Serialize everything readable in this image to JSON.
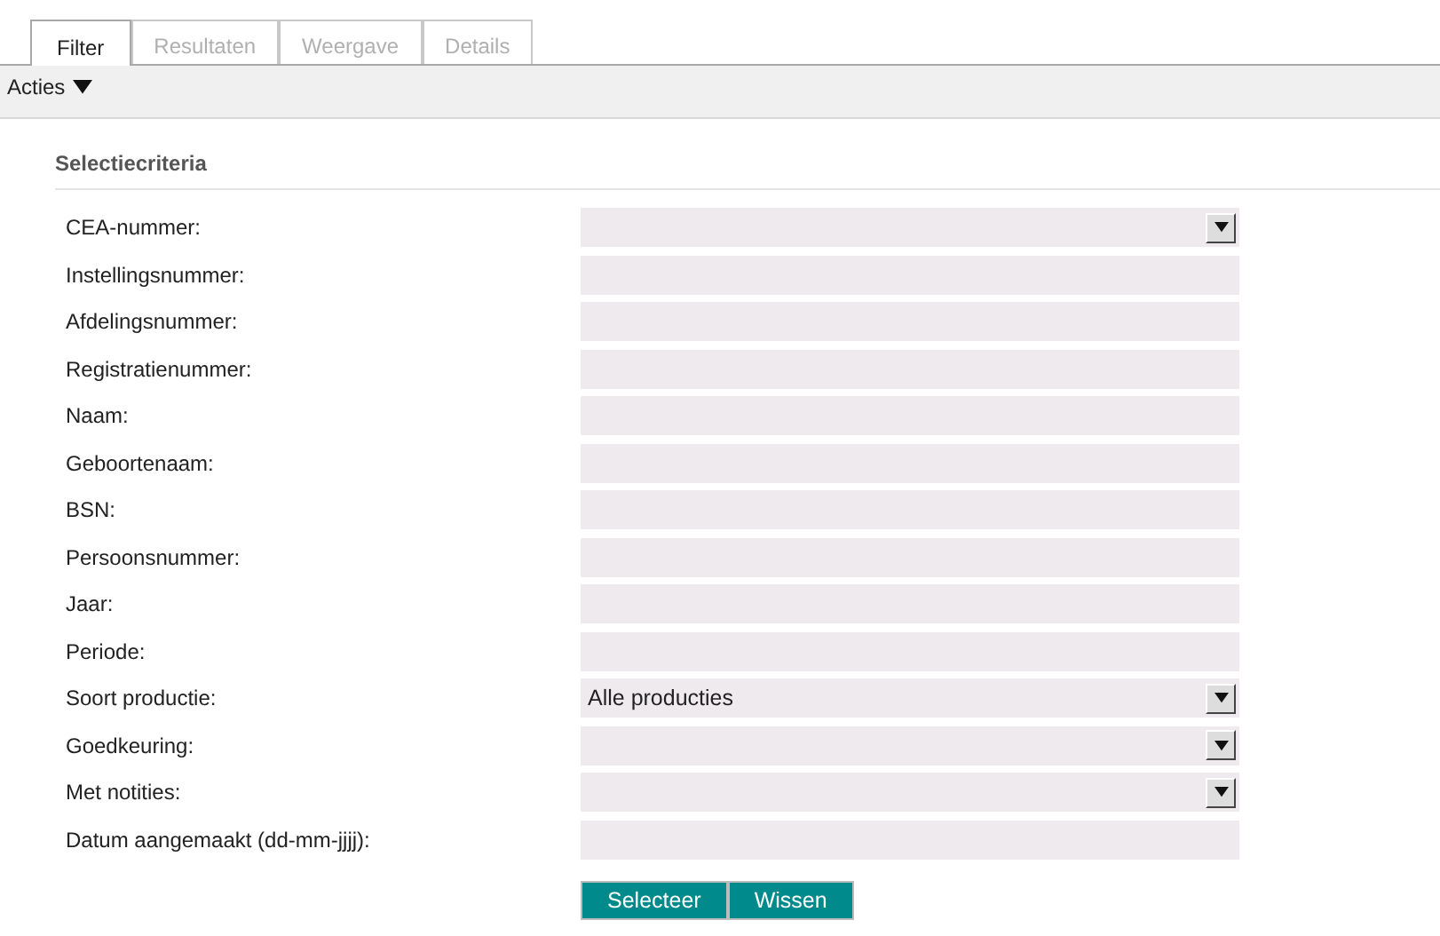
{
  "tabs": [
    {
      "label": "Filter",
      "selected": true
    },
    {
      "label": "Resultaten",
      "selected": false
    },
    {
      "label": "Weergave",
      "selected": false
    },
    {
      "label": "Details",
      "selected": false
    }
  ],
  "actions_menu": {
    "label": "Acties"
  },
  "section": {
    "title": "Selectiecriteria"
  },
  "fields": [
    {
      "label": "CEA-nummer:",
      "kind": "select"
    },
    {
      "label": "Instellingsnummer:",
      "kind": "text"
    },
    {
      "label": "Afdelingsnummer:",
      "kind": "text"
    },
    {
      "label": "Registratienummer:",
      "kind": "text"
    },
    {
      "label": "Naam:",
      "kind": "text"
    },
    {
      "label": "Geboortenaam:",
      "kind": "text"
    },
    {
      "label": "BSN:",
      "kind": "text"
    },
    {
      "label": "Persoonsnummer:",
      "kind": "text"
    },
    {
      "label": "Jaar:",
      "kind": "text"
    },
    {
      "label": "Periode:",
      "kind": "text"
    },
    {
      "label": "Soort productie:",
      "kind": "select",
      "value": "Alle producties"
    },
    {
      "label": "Goedkeuring:",
      "kind": "select"
    },
    {
      "label": "Met notities:",
      "kind": "select"
    },
    {
      "label": "Datum aangemaakt (dd-mm-jjjj):",
      "kind": "text"
    }
  ],
  "buttons": [
    "Selecteer",
    "Wissen"
  ]
}
